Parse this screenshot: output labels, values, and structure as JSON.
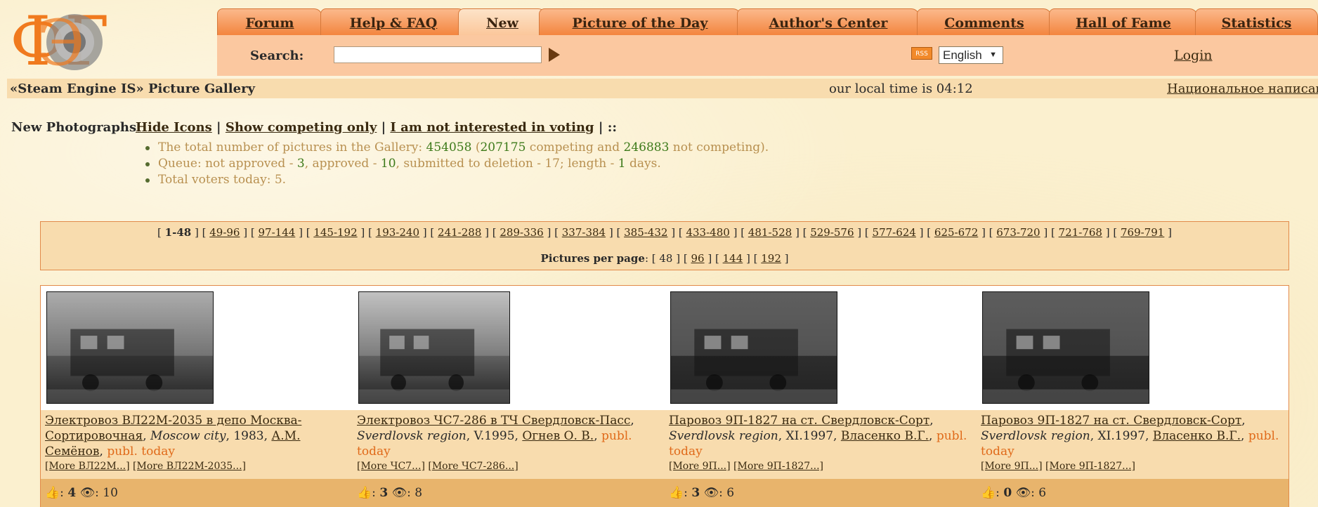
{
  "logo": {
    "alt": "ФЭГ"
  },
  "tabs": [
    {
      "label": "Forum",
      "active": false
    },
    {
      "label": "Help & FAQ",
      "active": false
    },
    {
      "label": "New",
      "active": true
    },
    {
      "label": "Picture of the Day",
      "active": false
    },
    {
      "label": "Author's Center",
      "active": false
    },
    {
      "label": "Comments",
      "active": false
    },
    {
      "label": "Hall of Fame",
      "active": false
    },
    {
      "label": "Statistics",
      "active": false
    }
  ],
  "search": {
    "label": "Search:",
    "value": "",
    "placeholder": ""
  },
  "rss": {
    "label": "RSS"
  },
  "language": {
    "selected": "English"
  },
  "login": {
    "label": "Login"
  },
  "header": {
    "gallery_title": "«Steam Engine IS» Picture Gallery",
    "local_time": "our local time is 04:12",
    "national_link": "Национальное написание"
  },
  "new_photos": {
    "label": "New Photographs:",
    "links": [
      "Hide Icons",
      "Show competing only",
      "I am not interested in voting"
    ],
    "tail": "| ::"
  },
  "stats": {
    "line1_pre": "The total number of pictures in the Gallery: ",
    "total": "454058",
    "competing": "207175",
    "line1_mid": " competing and ",
    "not_competing": "246883",
    "line1_post": " not competing).",
    "line2_pre": "Queue: not approved - ",
    "not_approved": "3",
    "line2_a": ", approved - ",
    "approved": "10",
    "line2_b": ", submitted to deletion - 17; length - ",
    "length": "1",
    "line2_c": " days.",
    "line3": "Total voters today: 5."
  },
  "pager": {
    "current": "1-48",
    "pages": [
      "49-96",
      "97-144",
      "145-192",
      "193-240",
      "241-288",
      "289-336",
      "337-384",
      "385-432",
      "433-480",
      "481-528",
      "529-576",
      "577-624",
      "625-672",
      "673-720",
      "721-768",
      "769-791"
    ],
    "per_page_label": "Pictures per page",
    "per_page_current": "48",
    "per_page_options": [
      "96",
      "144",
      "192"
    ]
  },
  "photos": [
    {
      "title": "Электровоз ВЛ22М-2035 в депо Москва-Сортировочная",
      "region": "Moscow city",
      "date": "1983",
      "author": "А.М. Семёнов",
      "publ": "publ. today",
      "more1": "[More ВЛ22М...]",
      "more2": "[More ВЛ22М-2035...]",
      "votes": "4",
      "views": "10",
      "thumb_color": "#9a9a9a"
    },
    {
      "title": "Электровоз ЧС7-286 в ТЧ Свердловск-Пасс",
      "region": "Sverdlovsk region",
      "date": "V.1995",
      "author": "Огнев О. В.",
      "publ": "publ. today",
      "more1": "[More ЧС7...]",
      "more2": "[More ЧС7-286...]",
      "votes": "3",
      "views": "8",
      "thumb_color": "#b4b4b4"
    },
    {
      "title": "Паровоз 9П-1827 на ст. Свердловск-Сорт",
      "region": "Sverdlovsk region",
      "date": "XI.1997",
      "author": "Власенко В.Г.",
      "publ": "publ. today",
      "more1": "[More 9П...]",
      "more2": "[More 9П-1827...]",
      "votes": "3",
      "views": "6",
      "thumb_color": "#3c3c3c"
    },
    {
      "title": "Паровоз 9П-1827 на ст. Свердловск-Сорт",
      "region": "Sverdlovsk region",
      "date": "XI.1997",
      "author": "Власенко В.Г.",
      "publ": "publ. today",
      "more1": "[More 9П...]",
      "more2": "[More 9П-1827...]",
      "votes": "0",
      "views": "6",
      "thumb_color": "#3a3a3a"
    }
  ]
}
